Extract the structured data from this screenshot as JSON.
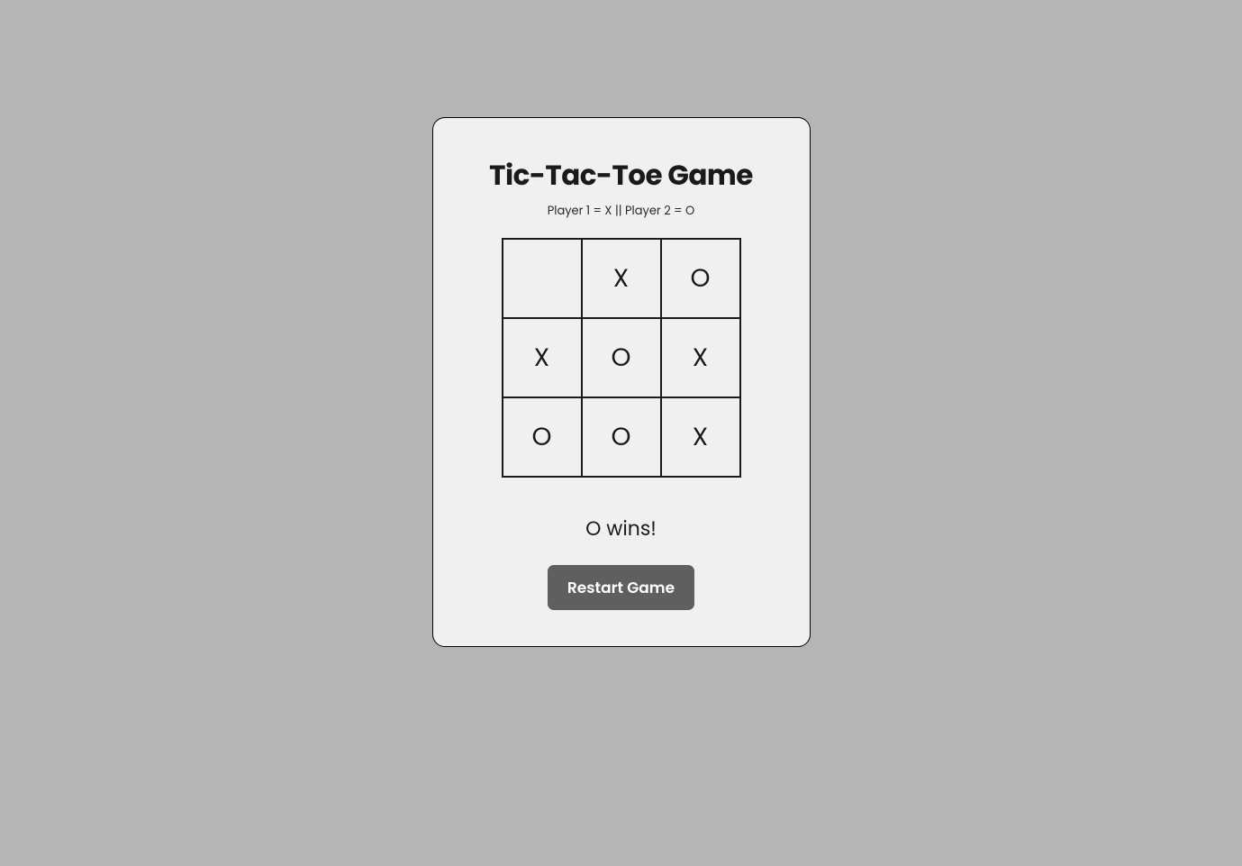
{
  "title": "Tic-Tac-Toe Game",
  "subtitle": "Player 1 = X || Player 2 = O",
  "board": {
    "cells": [
      "",
      "X",
      "O",
      "X",
      "O",
      "X",
      "O",
      "O",
      "X"
    ]
  },
  "status": "O wins!",
  "restart_label": "Restart Game"
}
